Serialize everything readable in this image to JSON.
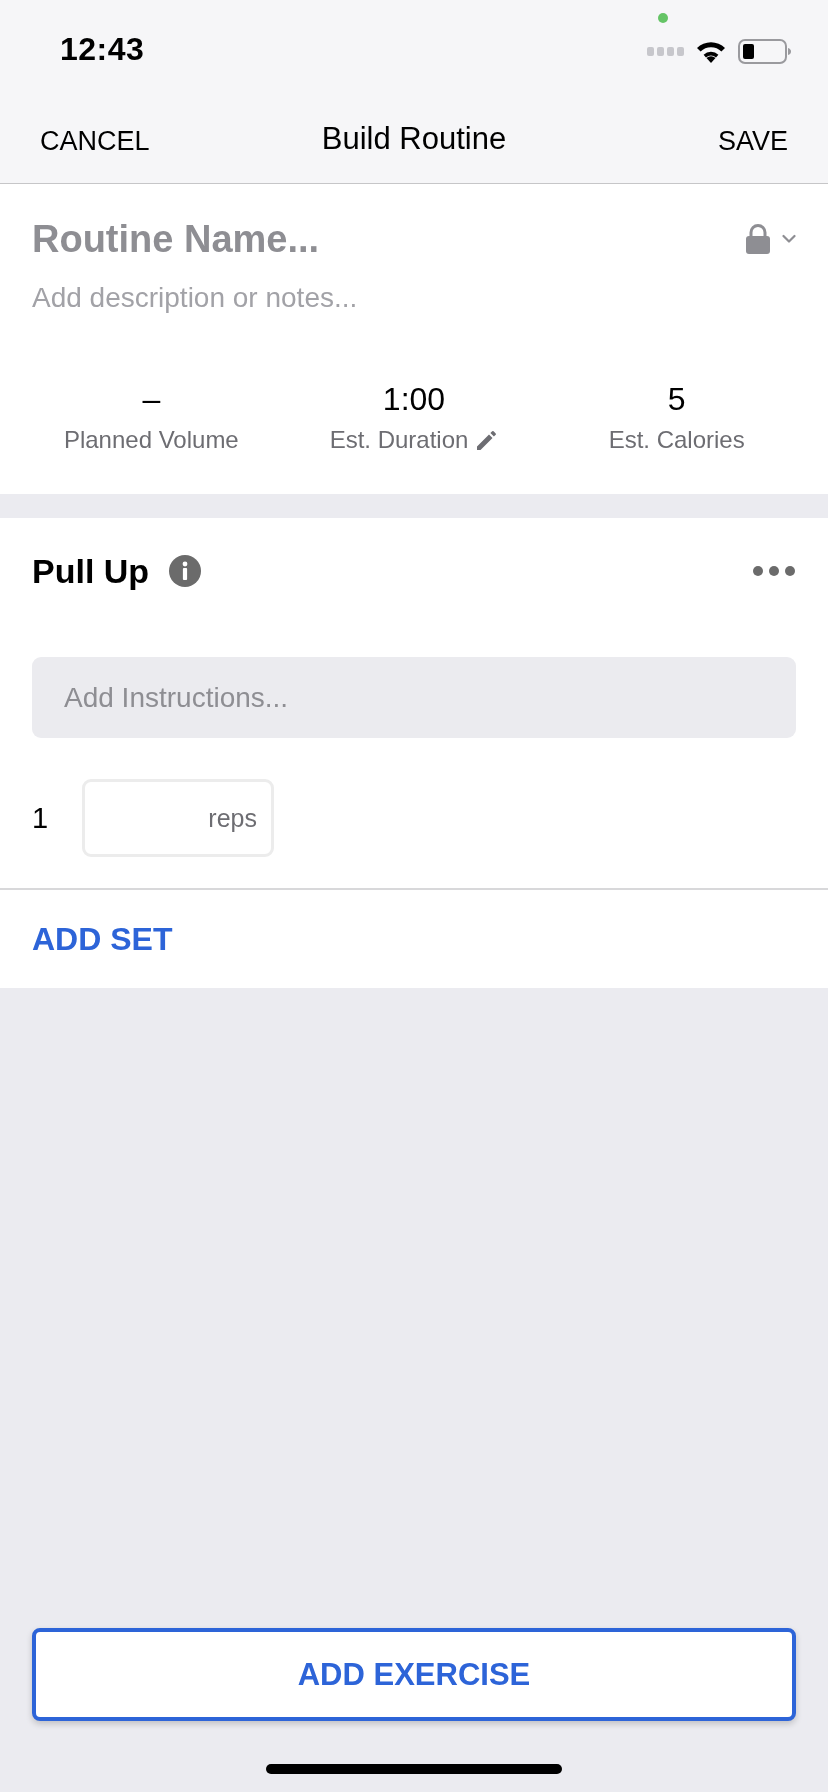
{
  "status_bar": {
    "time": "12:43"
  },
  "nav": {
    "cancel": "CANCEL",
    "title": "Build Routine",
    "save": "SAVE"
  },
  "routine": {
    "name": {
      "placeholder": "Routine Name..."
    },
    "description": {
      "placeholder": "Add description or notes..."
    },
    "stats": [
      {
        "value": "–",
        "label": "Planned Volume",
        "editable": false
      },
      {
        "value": "1:00",
        "label": "Est. Duration",
        "editable": true
      },
      {
        "value": "5",
        "label": "Est. Calories",
        "editable": false
      }
    ]
  },
  "exercises": [
    {
      "name": "Pull Up",
      "instructions": {
        "placeholder": "Add Instructions..."
      },
      "sets": [
        {
          "number": "1",
          "reps": {
            "placeholder": "reps"
          }
        }
      ],
      "add_set": "ADD SET"
    }
  ],
  "add_exercise": "ADD EXERCISE"
}
